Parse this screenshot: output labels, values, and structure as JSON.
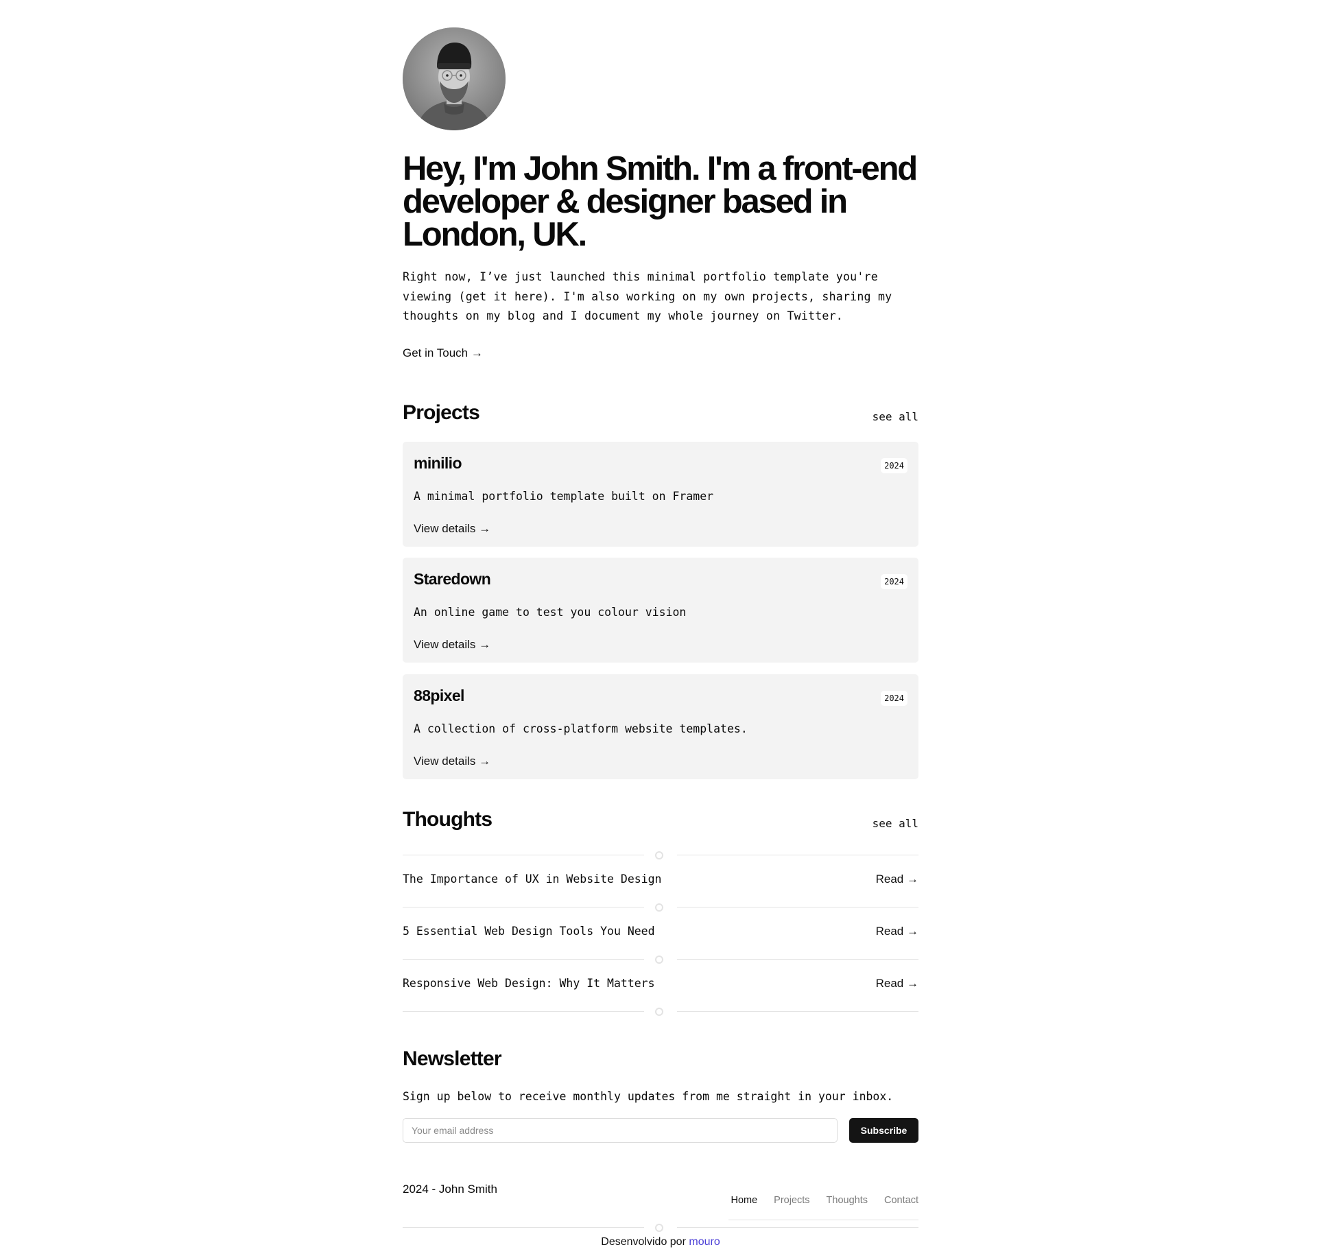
{
  "hero": {
    "title": "Hey, I'm John Smith. I'm a front-end developer & designer based in London, UK.",
    "text": "Right now, I’ve just launched this minimal portfolio template you're viewing (get it here). I'm also working on my own projects, sharing my thoughts on my blog and I document my whole journey on Twitter.",
    "cta": "Get in Touch →"
  },
  "projects": {
    "title": "Projects",
    "see_all": "see all",
    "items": [
      {
        "name": "minilio",
        "year": "2024",
        "description": "A minimal portfolio template built on Framer",
        "link": "View details  →"
      },
      {
        "name": "Staredown",
        "year": "2024",
        "description": "An online game to test you colour vision",
        "link": "View details  →"
      },
      {
        "name": "88pixel",
        "year": "2024",
        "description": "A collection of cross-platform website templates.",
        "link": "View details  →"
      }
    ]
  },
  "thoughts": {
    "title": "Thoughts",
    "see_all": "see all",
    "items": [
      {
        "title": "The Importance of UX in Website Design",
        "link": "Read →"
      },
      {
        "title": "5 Essential Web Design Tools You Need",
        "link": "Read →"
      },
      {
        "title": "Responsive Web Design: Why It Matters",
        "link": "Read →"
      }
    ]
  },
  "newsletter": {
    "title": "Newsletter",
    "text": "Sign up below to receive monthly updates from me straight in your inbox.",
    "placeholder": "Your email address",
    "button": "Subscribe"
  },
  "footer": {
    "copyright": "2024 - John Smith",
    "nav": [
      "Home",
      "Projects",
      "Thoughts",
      "Contact"
    ],
    "credit_prefix": "Desenvolvido por",
    "credit_link": "mouro"
  },
  "colors": {
    "card_bg": "#f3f3f3",
    "button_bg": "#141414",
    "credit_link": "#4b3fd6"
  },
  "icons": {
    "avatar": "portrait-photo",
    "arrow": "arrow-right-icon",
    "divider": "circle-divider-icon"
  }
}
